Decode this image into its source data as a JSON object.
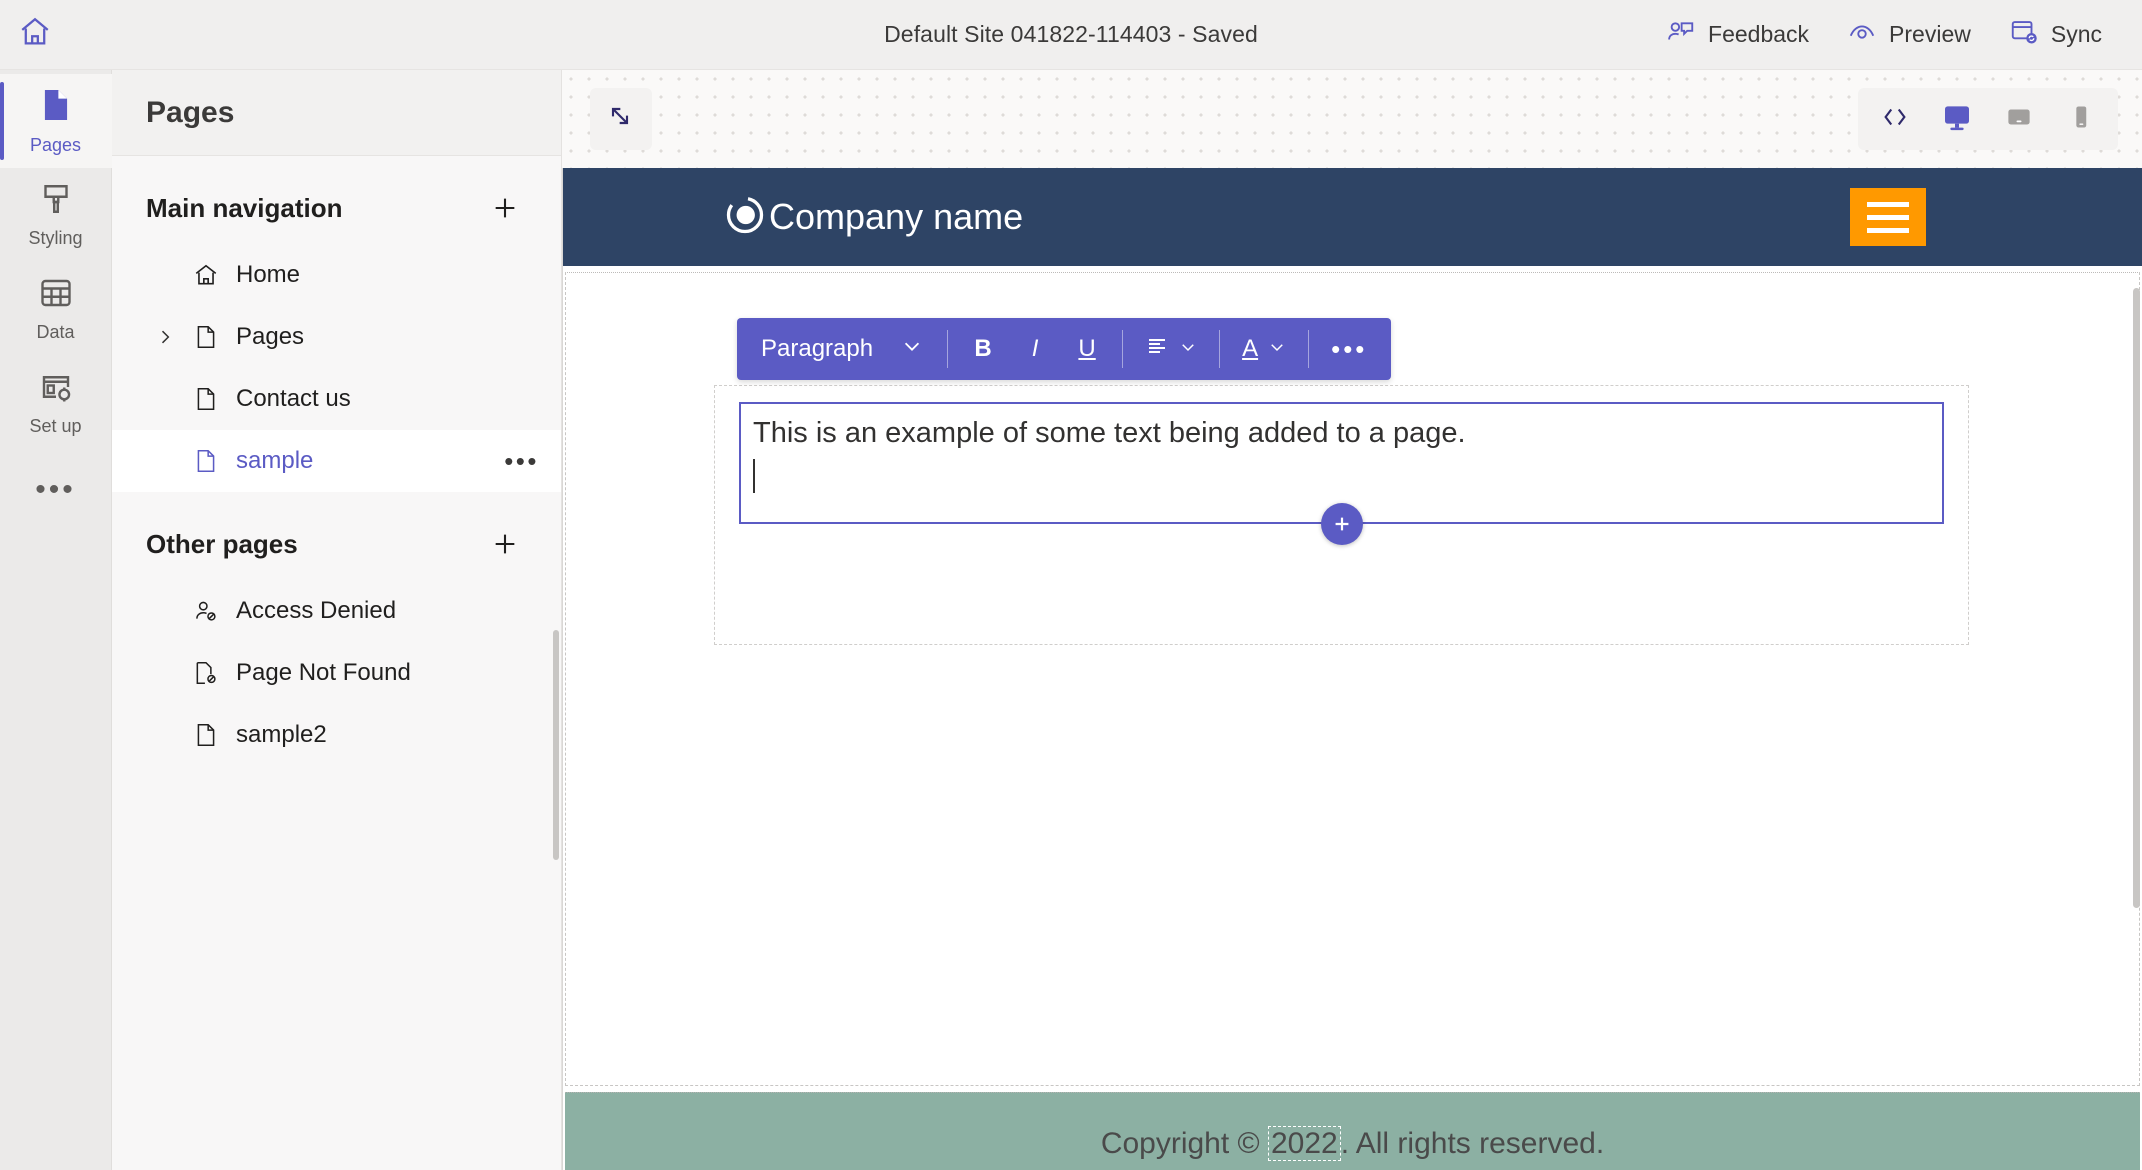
{
  "topbar": {
    "home_icon": "home-icon",
    "title": "Default Site 041822-114403 - Saved",
    "actions": [
      {
        "label": "Feedback",
        "icon": "feedback-person-icon"
      },
      {
        "label": "Preview",
        "icon": "eye-preview-icon"
      },
      {
        "label": "Sync",
        "icon": "sync-window-icon"
      }
    ]
  },
  "rail": {
    "items": [
      {
        "label": "Pages",
        "icon": "page-icon",
        "active": true
      },
      {
        "label": "Styling",
        "icon": "paint-brush-icon",
        "active": false
      },
      {
        "label": "Data",
        "icon": "table-grid-icon",
        "active": false
      },
      {
        "label": "Set up",
        "icon": "setup-gear-icon",
        "active": false
      }
    ],
    "more_label": "•••"
  },
  "panel": {
    "title": "Pages",
    "sections": [
      {
        "heading": "Main navigation",
        "add_label": "+",
        "items": [
          {
            "label": "Home",
            "icon": "home-outline-icon",
            "has_chevron": false,
            "selected": false,
            "has_menu": false
          },
          {
            "label": "Pages",
            "icon": "page-outline-icon",
            "has_chevron": true,
            "selected": false,
            "has_menu": false
          },
          {
            "label": "Contact us",
            "icon": "page-outline-icon",
            "has_chevron": false,
            "selected": false,
            "has_menu": false
          },
          {
            "label": "sample",
            "icon": "page-outline-icon",
            "has_chevron": false,
            "selected": true,
            "has_menu": true,
            "menu_label": "•••"
          }
        ]
      },
      {
        "heading": "Other pages",
        "add_label": "+",
        "items": [
          {
            "label": "Access Denied",
            "icon": "person-blocked-icon",
            "has_chevron": false,
            "selected": false,
            "has_menu": false
          },
          {
            "label": "Page Not Found",
            "icon": "page-blocked-icon",
            "has_chevron": false,
            "selected": false,
            "has_menu": false
          },
          {
            "label": "sample2",
            "icon": "page-outline-icon",
            "has_chevron": false,
            "selected": false,
            "has_menu": false
          }
        ]
      }
    ]
  },
  "canvas": {
    "expand_icon": "diagonal-resize-icon",
    "viewport_toggles": [
      {
        "name": "code-icon",
        "label": "</>",
        "active": false
      },
      {
        "name": "desktop-icon",
        "label": "",
        "active": true
      },
      {
        "name": "tablet-icon",
        "label": "",
        "active": false
      },
      {
        "name": "mobile-icon",
        "label": "",
        "active": false
      }
    ]
  },
  "site": {
    "header": {
      "logo_icon": "circular-logo-icon",
      "company_name": "Company name",
      "menu_icon": "hamburger-menu-icon"
    },
    "editor": {
      "toolbar": {
        "style_label": "Paragraph",
        "chevron": "chevron-down-icon",
        "bold_label": "B",
        "italic_label": "I",
        "underline_label": "U",
        "align_icon": "align-left-icon",
        "font_color_label": "A",
        "more_label": "•••"
      },
      "text": "This is an example of some text being added to a page.",
      "add_button_label": "+"
    },
    "footer": {
      "text_before": "Copyright © ",
      "year": "2022",
      "text_after": ". All rights reserved."
    }
  },
  "colors": {
    "accent_purple": "#5b5bc4",
    "site_header_navy": "#2e4465",
    "menu_orange": "#ff9900",
    "footer_green": "#8cb0a3"
  }
}
